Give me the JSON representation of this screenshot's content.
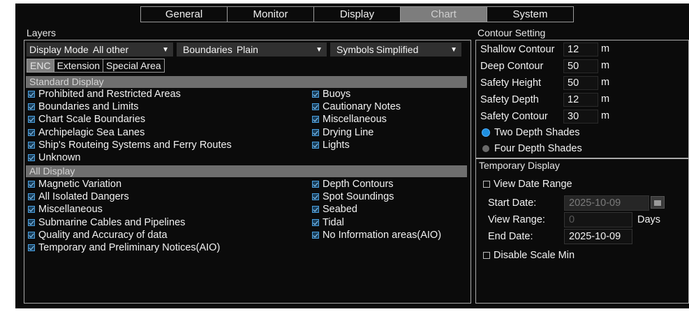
{
  "tabs": [
    {
      "label": "General"
    },
    {
      "label": "Monitor"
    },
    {
      "label": "Display"
    },
    {
      "label": "Chart",
      "active": true
    },
    {
      "label": "System"
    }
  ],
  "layers": {
    "title": "Layers",
    "display_mode": {
      "label": "Display Mode",
      "value": "All other"
    },
    "boundaries": {
      "label": "Boundaries",
      "value": "Plain"
    },
    "symbols": {
      "label": "Symbols",
      "value": "Simplified"
    },
    "subtabs": [
      "ENC",
      "Extension",
      "Special Area"
    ],
    "standard_display": {
      "title": "Standard Display",
      "left": [
        "Prohibited and Restricted Areas",
        "Boundaries and Limits",
        "Chart Scale Boundaries",
        "Archipelagic Sea Lanes",
        "Ship's Routeing Systems and Ferry Routes",
        "Unknown"
      ],
      "right": [
        "Buoys",
        "Cautionary Notes",
        "Miscellaneous",
        "Drying Line",
        "Lights"
      ]
    },
    "all_display": {
      "title": "All Display",
      "left": [
        "Magnetic Variation",
        "All Isolated Dangers",
        "Miscellaneous",
        "Submarine Cables and Pipelines",
        "Quality and Accuracy of data",
        "Temporary and Preliminary Notices(AIO)"
      ],
      "right": [
        "Depth Contours",
        "Spot Soundings",
        "Seabed",
        "Tidal",
        "No Information areas(AIO)"
      ]
    }
  },
  "contour": {
    "title": "Contour Setting",
    "rows": [
      {
        "label": "Shallow Contour",
        "value": "12",
        "unit": "m"
      },
      {
        "label": "Deep Contour",
        "value": "50",
        "unit": "m"
      },
      {
        "label": "Safety Height",
        "value": "50",
        "unit": "m"
      },
      {
        "label": "Safety Depth",
        "value": "12",
        "unit": "m"
      },
      {
        "label": "Safety Contour",
        "value": "30",
        "unit": "m"
      }
    ],
    "two_depth": "Two Depth Shades",
    "four_depth": "Four Depth Shades",
    "selected_color": "#1e8fe0"
  },
  "temporary": {
    "title": "Temporary Display",
    "view_date_range": "View Date Range",
    "start_label": "Start Date:",
    "start_value": "2025-10-09",
    "range_label": "View Range:",
    "range_value": "0",
    "range_unit": "Days",
    "end_label": "End Date:",
    "end_value": "2025-10-09",
    "disable_scale": "Disable Scale Min"
  }
}
